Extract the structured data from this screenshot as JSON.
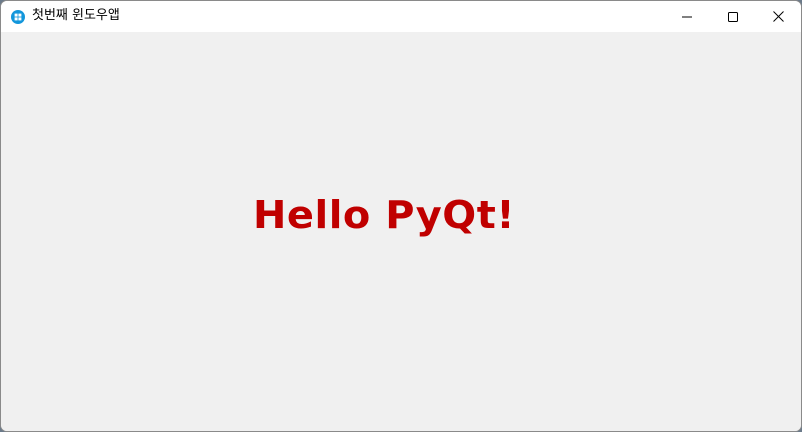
{
  "window": {
    "title": "첫번째 윈도우앱",
    "app_icon": "windows-app-icon",
    "controls": {
      "minimize_icon": "minimize-icon",
      "maximize_icon": "maximize-icon",
      "close_icon": "close-icon"
    }
  },
  "content": {
    "label_text": "Hello PyQt!",
    "label_color": "#c00000"
  },
  "colors": {
    "client_background": "#f0f0f0",
    "titlebar_background": "#ffffff",
    "app_icon": "#1296db"
  }
}
